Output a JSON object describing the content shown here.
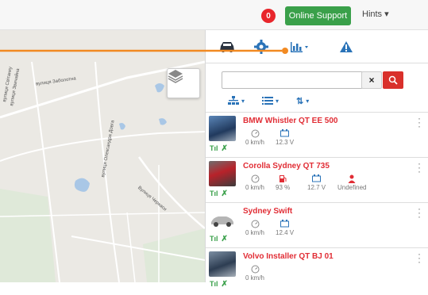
{
  "topbar": {
    "notification_count": "0",
    "support_label": "Online Support",
    "hints_label": "Hints"
  },
  "map": {
    "streets": [
      "вулиця Заболотна",
      "вулиця Свiтанку",
      "вулиця Звичайна",
      "вулиця Олександра Довга",
      "Вулиця Черкаси"
    ]
  },
  "search": {
    "placeholder": "",
    "clear_label": "×"
  },
  "vehicles": [
    {
      "name": "BMW Whistler QT EE 500",
      "speed": "0 km/h",
      "voltage": "12.3 V"
    },
    {
      "name": "Corolla Sydney QT 735",
      "speed": "0 km/h",
      "fuel": "93 %",
      "voltage": "12.7 V",
      "driver": "Undefined"
    },
    {
      "name": "Sydney Swift",
      "speed": "0 km/h",
      "voltage": "12.4 V"
    },
    {
      "name": "Volvo Installer QT BJ 01",
      "speed": "0 km/h"
    }
  ],
  "colors": {
    "accent_blue": "#2a73b8",
    "danger_red": "#e12d35",
    "success_green": "#3aa04a",
    "annotation_orange": "#f28a22"
  },
  "icons": {
    "tab1": "car-icon",
    "tab2": "gear-icon",
    "tab3": "bar-chart-icon",
    "tab4": "warning-icon"
  }
}
